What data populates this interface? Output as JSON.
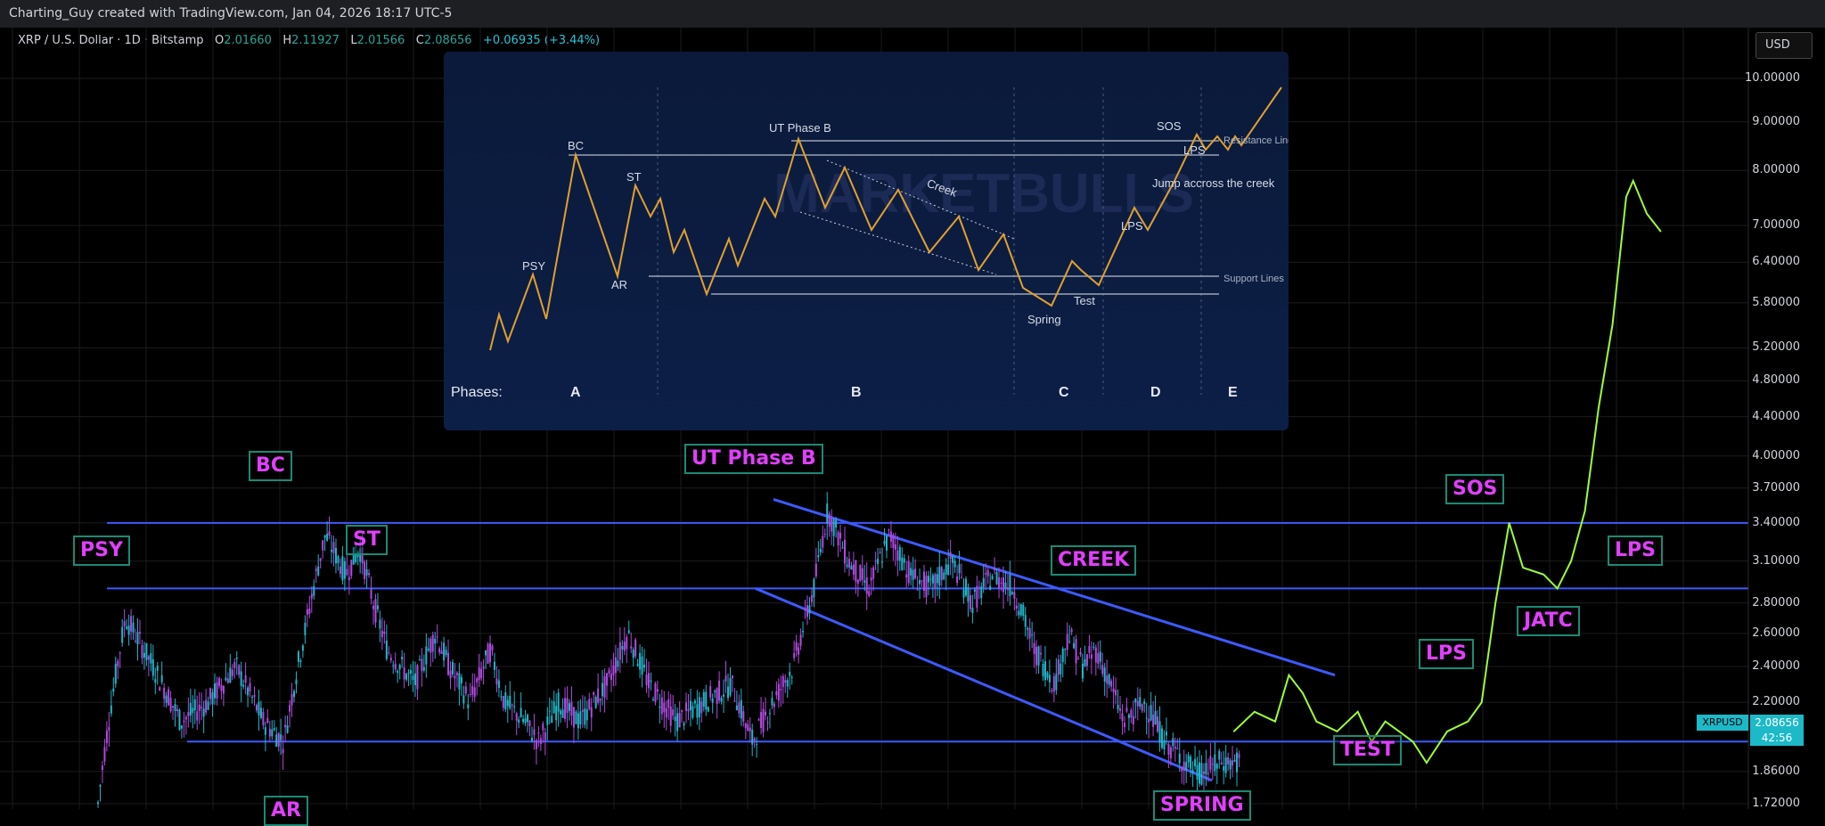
{
  "header": {
    "attribution": "Charting_Guy created with TradingView.com, Jan 04, 2026 18:17 UTC-5",
    "symbol": "XRP / U.S. Dollar · 1D · Bitstamp",
    "o_label": "O",
    "o_value": "2.01660",
    "h_label": "H",
    "h_value": "2.11927",
    "l_label": "L",
    "l_value": "2.01566",
    "c_label": "C",
    "c_value": "2.08656",
    "change": "+0.06935 (+3.44%)",
    "currency_button": "USD"
  },
  "price_tag": {
    "symbol": "XRPUSD",
    "price": "2.08656",
    "countdown": "42:56"
  },
  "colors": {
    "up": "#26a69a",
    "down": "#e040fb",
    "wick": "#6fb7ff",
    "projection": "#9cff3a",
    "lines": "#3d5afe",
    "label_text": "#e040fb",
    "label_border": "#1b8a74"
  },
  "chart_data": [
    {
      "type": "line",
      "title": "",
      "y_scale": "log",
      "y_ticks": [
        "10.00000",
        "9.00000",
        "8.00000",
        "7.00000",
        "6.40000",
        "5.80000",
        "5.20000",
        "4.80000",
        "4.40000",
        "4.00000",
        "3.70000",
        "3.40000",
        "3.10000",
        "2.80000",
        "2.60000",
        "2.40000",
        "2.20000",
        "2.00000",
        "1.86000",
        "1.72000"
      ],
      "horizontal_levels": [
        3.4,
        2.9,
        2.0
      ],
      "series": [
        {
          "points": [
            [
              0,
              1.72
            ],
            [
              20,
              2.7
            ],
            [
              40,
              2.4
            ],
            [
              60,
              2.1
            ],
            [
              80,
              2.2
            ],
            [
              100,
              2.4
            ],
            [
              120,
              2.1
            ],
            [
              135,
              2.0
            ],
            [
              150,
              2.6
            ],
            [
              165,
              3.3
            ],
            [
              180,
              3.0
            ],
            [
              190,
              3.2
            ],
            [
              200,
              2.8
            ],
            [
              210,
              2.5
            ],
            [
              230,
              2.3
            ],
            [
              245,
              2.6
            ],
            [
              255,
              2.4
            ],
            [
              270,
              2.2
            ],
            [
              285,
              2.5
            ],
            [
              295,
              2.2
            ],
            [
              310,
              2.1
            ],
            [
              320,
              2.0
            ],
            [
              335,
              2.2
            ],
            [
              350,
              2.1
            ],
            [
              370,
              2.3
            ],
            [
              385,
              2.6
            ],
            [
              400,
              2.3
            ],
            [
              420,
              2.1
            ],
            [
              440,
              2.2
            ],
            [
              460,
              2.3
            ],
            [
              475,
              2.0
            ],
            [
              490,
              2.2
            ],
            [
              505,
              2.4
            ],
            [
              520,
              2.9
            ],
            [
              530,
              3.5
            ],
            [
              545,
              3.1
            ],
            [
              560,
              2.9
            ],
            [
              575,
              3.3
            ],
            [
              590,
              3.0
            ],
            [
              605,
              2.9
            ],
            [
              620,
              3.1
            ],
            [
              635,
              2.8
            ],
            [
              650,
              3.0
            ],
            [
              665,
              2.9
            ],
            [
              680,
              2.5
            ],
            [
              695,
              2.3
            ],
            [
              705,
              2.6
            ],
            [
              715,
              2.4
            ],
            [
              725,
              2.5
            ],
            [
              735,
              2.3
            ],
            [
              745,
              2.1
            ],
            [
              760,
              2.2
            ],
            [
              775,
              2.0
            ],
            [
              790,
              1.9
            ],
            [
              800,
              1.85
            ],
            [
              815,
              1.9
            ],
            [
              830,
              1.9
            ]
          ]
        },
        {
          "points": [
            [
              825,
              2.05
            ],
            [
              840,
              2.15
            ],
            [
              855,
              2.1
            ],
            [
              865,
              2.35
            ],
            [
              875,
              2.25
            ],
            [
              885,
              2.1
            ],
            [
              900,
              2.05
            ],
            [
              915,
              2.15
            ],
            [
              925,
              2.0
            ],
            [
              935,
              2.1
            ],
            [
              945,
              2.05
            ],
            [
              955,
              2.0
            ],
            [
              965,
              1.9
            ],
            [
              980,
              2.05
            ],
            [
              995,
              2.1
            ],
            [
              1005,
              2.2
            ],
            [
              1015,
              2.8
            ],
            [
              1025,
              3.4
            ],
            [
              1035,
              3.05
            ],
            [
              1050,
              3.0
            ],
            [
              1060,
              2.9
            ],
            [
              1070,
              3.1
            ],
            [
              1080,
              3.5
            ],
            [
              1090,
              4.5
            ],
            [
              1100,
              5.5
            ],
            [
              1110,
              7.5
            ],
            [
              1115,
              7.8
            ],
            [
              1125,
              7.2
            ],
            [
              1135,
              6.9
            ]
          ]
        }
      ]
    },
    {
      "type": "line",
      "title": "",
      "phases": [
        "Phases:",
        "A",
        "B",
        "C",
        "D",
        "E"
      ],
      "labels": [
        "PSY",
        "BC",
        "ST",
        "AR",
        "UT Phase B",
        "Creek",
        "Spring",
        "Test",
        "LPS",
        "SOS",
        "LPS",
        "Jump accross the creek",
        "Resistance Lines",
        "Support Lines"
      ],
      "watermark": "MARKETBULLS"
    }
  ],
  "annotations": {
    "psy": "PSY",
    "bc": "BC",
    "st": "ST",
    "ar": "AR",
    "ut": "UT Phase B",
    "creek": "CREEK",
    "spring": "SPRING",
    "test": "TEST",
    "lps1": "LPS",
    "sos": "SOS",
    "jatc": "JATC",
    "lps2": "LPS"
  }
}
